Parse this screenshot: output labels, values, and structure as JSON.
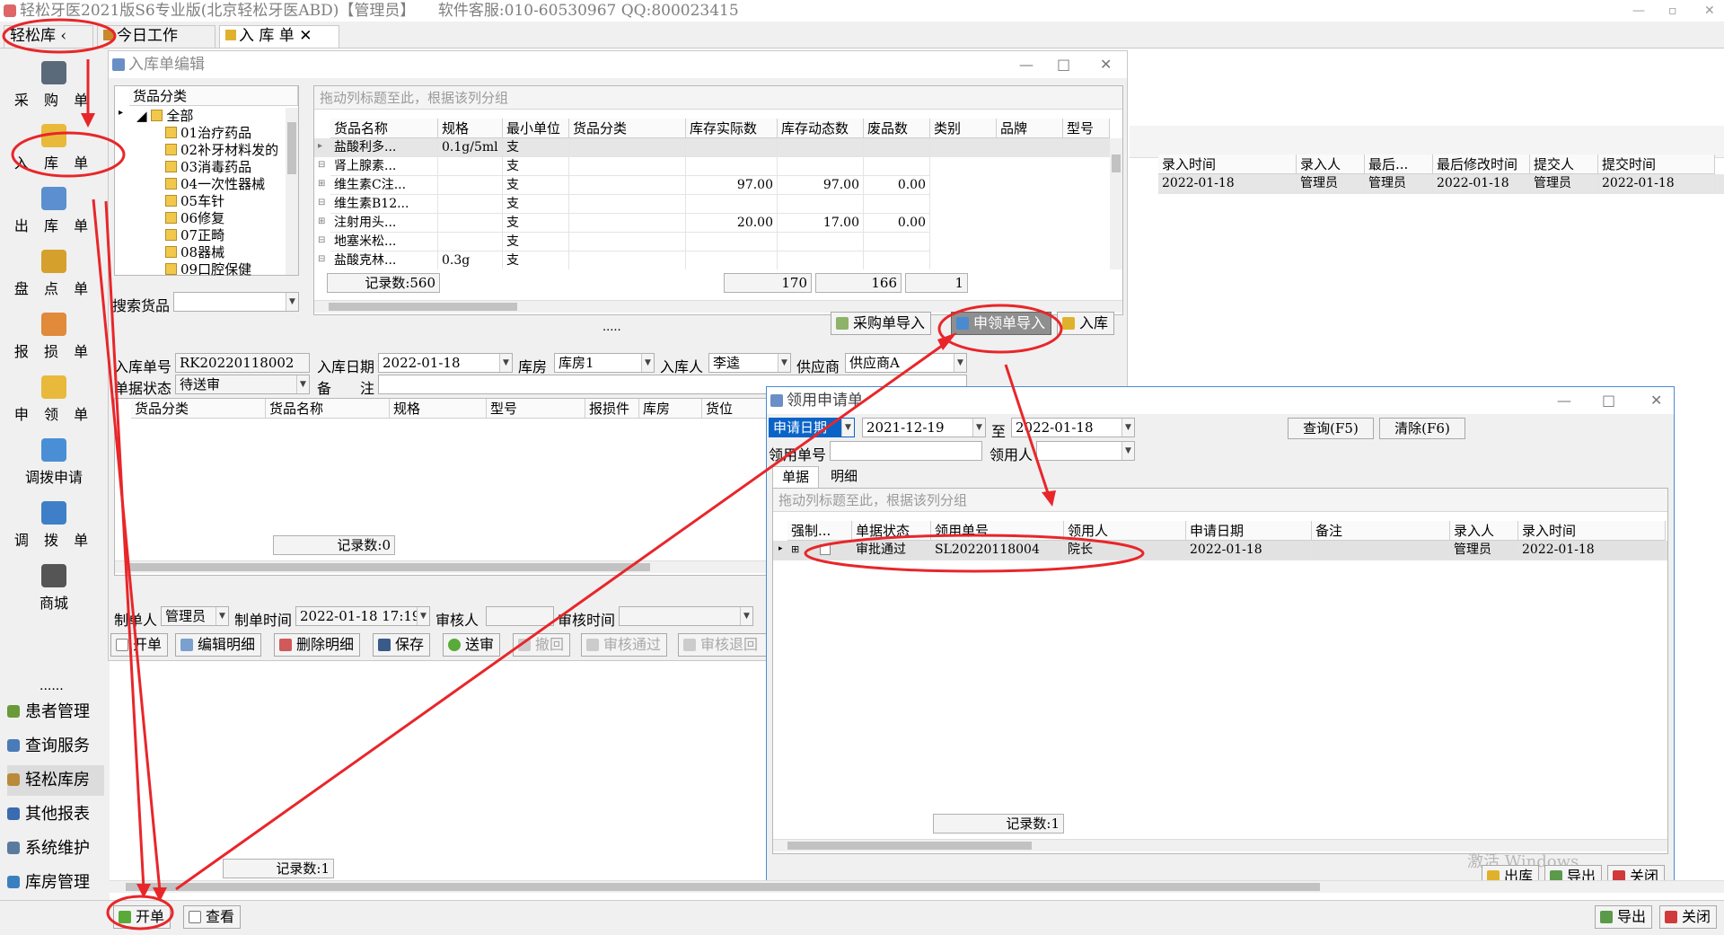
{
  "app": {
    "title": "轻松牙医2021版S6专业版(北京轻松牙医ABD)【管理员】",
    "service": "软件客服:010-60530967 QQ:800023415"
  },
  "tabs": [
    {
      "label": "轻松库"
    },
    {
      "label": "今日工作"
    },
    {
      "label": "入 库 单"
    }
  ],
  "sidebar": {
    "buttons": [
      "采 购 单",
      "入 库 单",
      "出 库 单",
      "盘 点 单",
      "报 损 单",
      "申 领 单",
      "调拨申请",
      "调 拨 单",
      "商城"
    ],
    "more": "......",
    "modules": [
      "患者管理",
      "查询服务",
      "轻松库房",
      "其他报表",
      "系统维护",
      "库房管理"
    ],
    "ellipsis": "..."
  },
  "colors": {
    "annotation": "#e8262a",
    "selected_blue": "#0a64c8"
  },
  "bg_list": {
    "headers": [
      "录入时间",
      "录入人",
      "最后...",
      "最后修改时间",
      "提交人",
      "提交时间"
    ],
    "row": [
      "2022-01-18",
      "管理员",
      "管理员",
      "2022-01-18",
      "管理员",
      "2022-01-18"
    ]
  },
  "rk_window": {
    "title": "入库单编辑",
    "category_header": "货品分类",
    "tree": [
      "全部",
      "01治疗药品",
      "02补牙材料发的",
      "03消毒药品",
      "04一次性器械",
      "05车针",
      "06修复",
      "07正畸",
      "08器械",
      "09口腔保健"
    ],
    "search_label": "搜索货品",
    "group_hint": "拖动列标题至此，根据该列分组",
    "goods_headers": [
      "货品名称",
      "规格",
      "最小单位",
      "货品分类",
      "库存实际数",
      "库存动态数",
      "废品数",
      "类别",
      "品牌",
      "型号"
    ],
    "goods_rows": [
      [
        "盐酸利多...",
        "0.1g/5ml",
        "支",
        "",
        "",
        "",
        ""
      ],
      [
        "肾上腺素...",
        "",
        "支",
        "",
        "",
        "",
        ""
      ],
      [
        "维生素C注...",
        "",
        "支",
        "",
        "97.00",
        "97.00",
        "0.00"
      ],
      [
        "维生素B12...",
        "",
        "支",
        "",
        "",
        "",
        ""
      ],
      [
        "注射用头...",
        "",
        "支",
        "",
        "20.00",
        "17.00",
        "0.00"
      ],
      [
        "地塞米松...",
        "",
        "支",
        "",
        "",
        "",
        ""
      ],
      [
        "盐酸克林...",
        "0.3g",
        "支",
        "",
        "",
        "",
        ""
      ]
    ],
    "record_count": "记录数:560",
    "sum1": "170",
    "sum2": "166",
    "sum3": "1",
    "btn_purchase": "采购单导入",
    "btn_apply": "申领单导入",
    "btn_in": "入库",
    "dots": ".....",
    "form": {
      "no_label": "入库单号",
      "no_value": "RK20220118002",
      "date_label": "入库日期",
      "date_value": "2022-01-18",
      "store_label": "库房",
      "store_value": "库房1",
      "person_label": "入库人",
      "person_value": "李逵",
      "supplier_label": "供应商",
      "supplier_value": "供应商A",
      "status_label": "单据状态",
      "status_value": "待送审",
      "remark_label": "备　　注"
    },
    "detail_headers": [
      "货品分类",
      "货品名称",
      "规格",
      "型号",
      "报损件",
      "库房",
      "货位"
    ],
    "detail_count": "记录数:0",
    "maker_label": "制单人",
    "maker_value": "管理员",
    "make_time_label": "制单时间",
    "make_time_value": "2022-01-18 17:19",
    "auditor_label": "审核人",
    "audit_time_label": "审核时间",
    "actions": [
      "开单",
      "编辑明细",
      "删除明细",
      "保存",
      "送审",
      "撤回",
      "审核通过",
      "审核退回"
    ]
  },
  "sl_window": {
    "title": "领用申请单",
    "date_filter": "申请日期",
    "date_from": "2021-12-19",
    "to": "至",
    "date_to": "2022-01-18",
    "btn_query": "查询(F5)",
    "btn_clear": "清除(F6)",
    "no_label": "领用单号",
    "user_label": "领用人",
    "subtabs": [
      "单据",
      "明细"
    ],
    "group_hint": "拖动列标题至此，根据该列分组",
    "headers": [
      "强制...",
      "单据状态",
      "领用单号",
      "领用人",
      "申请日期",
      "备注",
      "录入人",
      "录入时间"
    ],
    "row": [
      "",
      "审批通过",
      "SL20220118004",
      "院长",
      "2022-01-18",
      "",
      "管理员",
      "2022-01-18"
    ],
    "record_count": "记录数:1",
    "btn_out": "出库",
    "btn_export": "导出",
    "btn_close": "关闭",
    "watermark": "激活 Windows"
  },
  "bottom": {
    "record_count": "记录数:1",
    "btn_new": "开单",
    "btn_view": "查看",
    "btn_export": "导出",
    "btn_close": "关闭"
  }
}
